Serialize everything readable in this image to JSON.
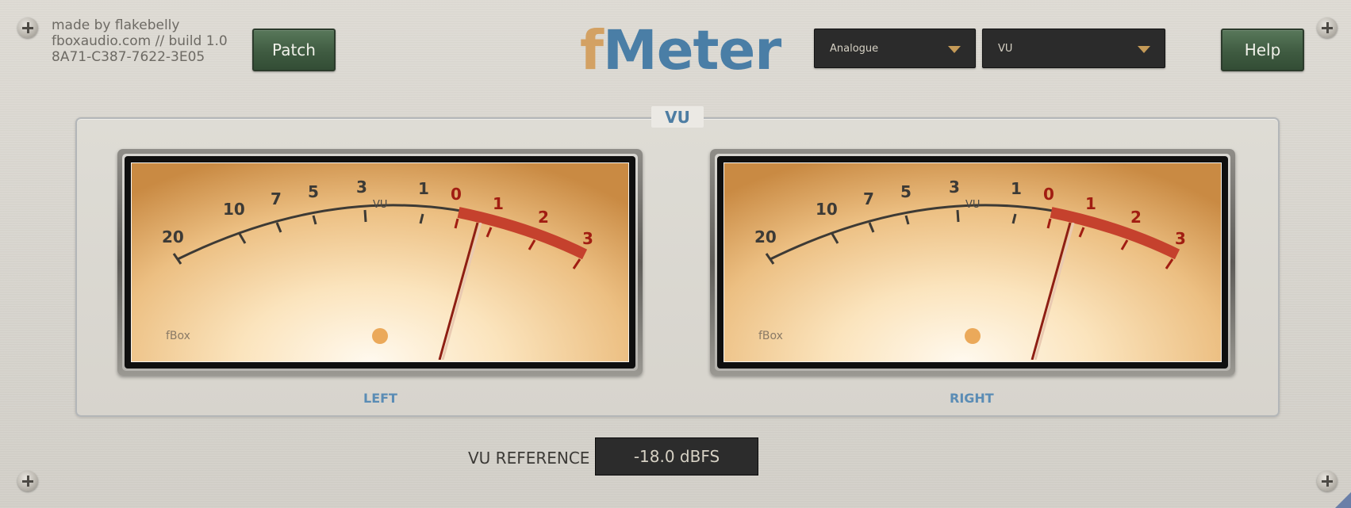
{
  "header": {
    "credits": [
      "made by flakebelly",
      "fboxaudio.com // build 1.0",
      "8A71-C387-7622-3E05"
    ],
    "patch_label": "Patch",
    "help_label": "Help",
    "logo_f": "f",
    "logo_meter": "Meter",
    "mode_dropdown": "Analogue",
    "type_dropdown": "VU"
  },
  "panel": {
    "title": "VU",
    "scale_labels": [
      "20",
      "10",
      "7",
      "5",
      "3",
      "1",
      "0",
      "1",
      "2",
      "3"
    ],
    "unit_label": "VU",
    "brand": "fBox",
    "left_label": "LEFT",
    "right_label": "RIGHT",
    "left_needle_vu": 0.25,
    "right_needle_vu": 0.25
  },
  "reference": {
    "label": "VU REFERENCE",
    "value": "-18.0 dBFS"
  },
  "colors": {
    "accent_blue": "#4a7ea6",
    "logo_orange": "#d3a163",
    "button_green": "#3f5b41",
    "redzone": "#c0392b"
  }
}
